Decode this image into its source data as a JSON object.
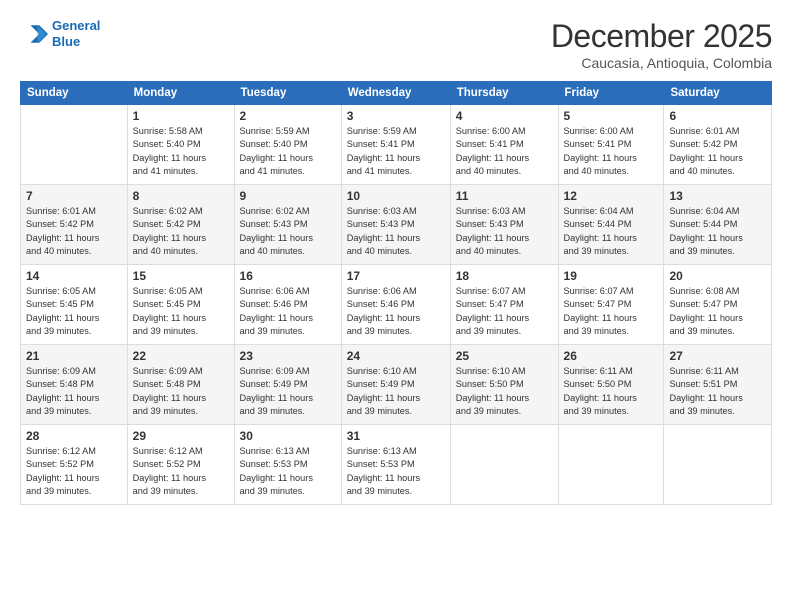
{
  "logo": {
    "line1": "General",
    "line2": "Blue"
  },
  "title": "December 2025",
  "subtitle": "Caucasia, Antioquia, Colombia",
  "weekdays": [
    "Sunday",
    "Monday",
    "Tuesday",
    "Wednesday",
    "Thursday",
    "Friday",
    "Saturday"
  ],
  "weeks": [
    [
      {
        "day": "",
        "info": ""
      },
      {
        "day": "1",
        "info": "Sunrise: 5:58 AM\nSunset: 5:40 PM\nDaylight: 11 hours\nand 41 minutes."
      },
      {
        "day": "2",
        "info": "Sunrise: 5:59 AM\nSunset: 5:40 PM\nDaylight: 11 hours\nand 41 minutes."
      },
      {
        "day": "3",
        "info": "Sunrise: 5:59 AM\nSunset: 5:41 PM\nDaylight: 11 hours\nand 41 minutes."
      },
      {
        "day": "4",
        "info": "Sunrise: 6:00 AM\nSunset: 5:41 PM\nDaylight: 11 hours\nand 40 minutes."
      },
      {
        "day": "5",
        "info": "Sunrise: 6:00 AM\nSunset: 5:41 PM\nDaylight: 11 hours\nand 40 minutes."
      },
      {
        "day": "6",
        "info": "Sunrise: 6:01 AM\nSunset: 5:42 PM\nDaylight: 11 hours\nand 40 minutes."
      }
    ],
    [
      {
        "day": "7",
        "info": "Sunrise: 6:01 AM\nSunset: 5:42 PM\nDaylight: 11 hours\nand 40 minutes."
      },
      {
        "day": "8",
        "info": "Sunrise: 6:02 AM\nSunset: 5:42 PM\nDaylight: 11 hours\nand 40 minutes."
      },
      {
        "day": "9",
        "info": "Sunrise: 6:02 AM\nSunset: 5:43 PM\nDaylight: 11 hours\nand 40 minutes."
      },
      {
        "day": "10",
        "info": "Sunrise: 6:03 AM\nSunset: 5:43 PM\nDaylight: 11 hours\nand 40 minutes."
      },
      {
        "day": "11",
        "info": "Sunrise: 6:03 AM\nSunset: 5:43 PM\nDaylight: 11 hours\nand 40 minutes."
      },
      {
        "day": "12",
        "info": "Sunrise: 6:04 AM\nSunset: 5:44 PM\nDaylight: 11 hours\nand 39 minutes."
      },
      {
        "day": "13",
        "info": "Sunrise: 6:04 AM\nSunset: 5:44 PM\nDaylight: 11 hours\nand 39 minutes."
      }
    ],
    [
      {
        "day": "14",
        "info": "Sunrise: 6:05 AM\nSunset: 5:45 PM\nDaylight: 11 hours\nand 39 minutes."
      },
      {
        "day": "15",
        "info": "Sunrise: 6:05 AM\nSunset: 5:45 PM\nDaylight: 11 hours\nand 39 minutes."
      },
      {
        "day": "16",
        "info": "Sunrise: 6:06 AM\nSunset: 5:46 PM\nDaylight: 11 hours\nand 39 minutes."
      },
      {
        "day": "17",
        "info": "Sunrise: 6:06 AM\nSunset: 5:46 PM\nDaylight: 11 hours\nand 39 minutes."
      },
      {
        "day": "18",
        "info": "Sunrise: 6:07 AM\nSunset: 5:47 PM\nDaylight: 11 hours\nand 39 minutes."
      },
      {
        "day": "19",
        "info": "Sunrise: 6:07 AM\nSunset: 5:47 PM\nDaylight: 11 hours\nand 39 minutes."
      },
      {
        "day": "20",
        "info": "Sunrise: 6:08 AM\nSunset: 5:47 PM\nDaylight: 11 hours\nand 39 minutes."
      }
    ],
    [
      {
        "day": "21",
        "info": "Sunrise: 6:09 AM\nSunset: 5:48 PM\nDaylight: 11 hours\nand 39 minutes."
      },
      {
        "day": "22",
        "info": "Sunrise: 6:09 AM\nSunset: 5:48 PM\nDaylight: 11 hours\nand 39 minutes."
      },
      {
        "day": "23",
        "info": "Sunrise: 6:09 AM\nSunset: 5:49 PM\nDaylight: 11 hours\nand 39 minutes."
      },
      {
        "day": "24",
        "info": "Sunrise: 6:10 AM\nSunset: 5:49 PM\nDaylight: 11 hours\nand 39 minutes."
      },
      {
        "day": "25",
        "info": "Sunrise: 6:10 AM\nSunset: 5:50 PM\nDaylight: 11 hours\nand 39 minutes."
      },
      {
        "day": "26",
        "info": "Sunrise: 6:11 AM\nSunset: 5:50 PM\nDaylight: 11 hours\nand 39 minutes."
      },
      {
        "day": "27",
        "info": "Sunrise: 6:11 AM\nSunset: 5:51 PM\nDaylight: 11 hours\nand 39 minutes."
      }
    ],
    [
      {
        "day": "28",
        "info": "Sunrise: 6:12 AM\nSunset: 5:52 PM\nDaylight: 11 hours\nand 39 minutes."
      },
      {
        "day": "29",
        "info": "Sunrise: 6:12 AM\nSunset: 5:52 PM\nDaylight: 11 hours\nand 39 minutes."
      },
      {
        "day": "30",
        "info": "Sunrise: 6:13 AM\nSunset: 5:53 PM\nDaylight: 11 hours\nand 39 minutes."
      },
      {
        "day": "31",
        "info": "Sunrise: 6:13 AM\nSunset: 5:53 PM\nDaylight: 11 hours\nand 39 minutes."
      },
      {
        "day": "",
        "info": ""
      },
      {
        "day": "",
        "info": ""
      },
      {
        "day": "",
        "info": ""
      }
    ]
  ]
}
